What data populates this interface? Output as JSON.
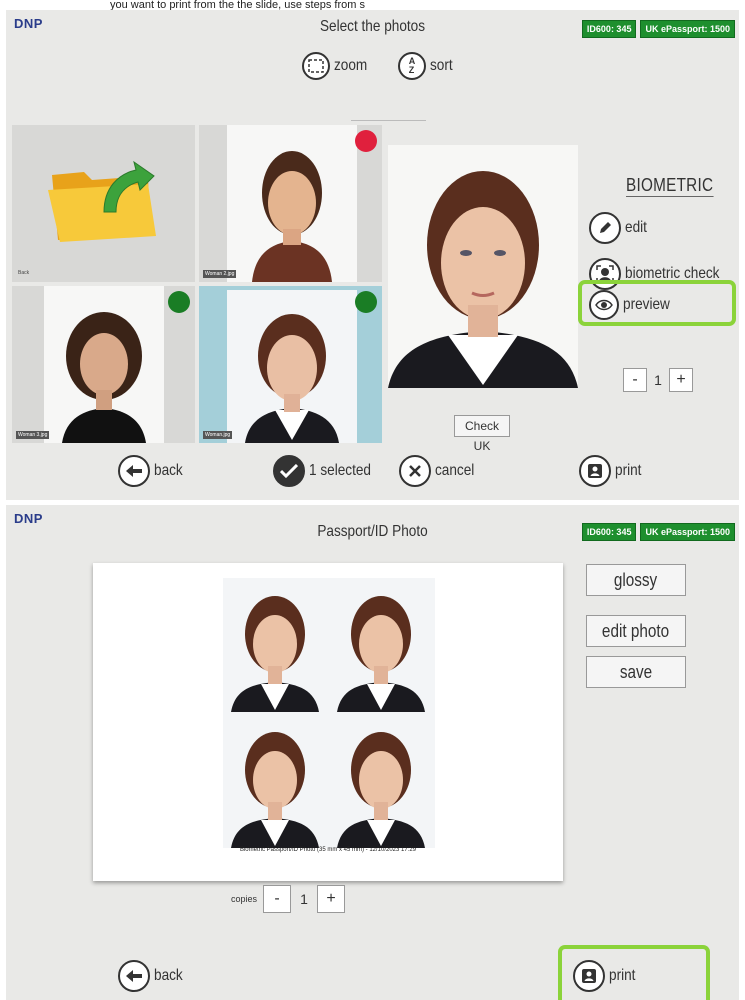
{
  "caption_top": "you want to print from the the slide, use steps from s",
  "screen1": {
    "logo": "DNP",
    "title": "Select the photos",
    "badges": [
      "ID600: 345",
      "UK ePassport: 1500"
    ],
    "zoom_label": "zoom",
    "sort_label": "sort",
    "tiles": [
      {
        "name": "Back",
        "dot": "none"
      },
      {
        "name": "Woman 2.jpg",
        "dot": "red"
      },
      {
        "name": "Woman 3.jpg",
        "dot": "green"
      },
      {
        "name": "Woman.jpg",
        "dot": "green"
      }
    ],
    "check_uk": "Check UK",
    "biometric_heading": "BIOMETRIC",
    "edit_label": "edit",
    "biometric_check_label": "biometric check",
    "preview_label": "preview",
    "quantity": "1",
    "minus": "-",
    "plus": "+",
    "back_label": "back",
    "selected_label": "1 selected",
    "cancel_label": "cancel",
    "print_label": "print"
  },
  "screen2": {
    "logo": "DNP",
    "title": "Passport/ID Photo",
    "badges": [
      "ID600: 345",
      "UK ePassport: 1500"
    ],
    "print_caption": "Biometric Passport/ID Photo (35 mm x 45 mm) - 12/10/2023 17:29",
    "glossy_label": "glossy",
    "edit_photo_label": "edit photo",
    "save_label": "save",
    "copies_label": "copies",
    "copies_value": "1",
    "minus": "-",
    "plus": "+",
    "back_label": "back",
    "print_label": "print"
  },
  "colors": {
    "highlight": "#8bd33a",
    "badge": "#1e8f2e",
    "selected_tile": "#a4cfd9",
    "dot_red": "#e0203d",
    "dot_green": "#1a7d25"
  }
}
